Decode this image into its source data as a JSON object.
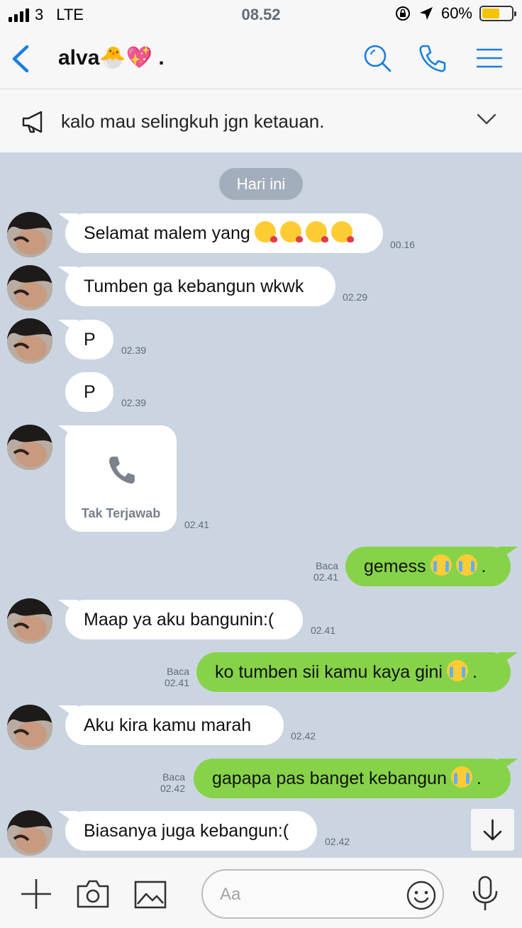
{
  "status_bar": {
    "carrier": "3",
    "network": "LTE",
    "time": "08.52",
    "battery": "60%",
    "battery_level": 0.6
  },
  "header": {
    "contact_name": "alva🐣💖 ."
  },
  "announcement": {
    "text": "kalo mau selingkuh jgn ketauan."
  },
  "chat": {
    "date_divider": "Hari ini",
    "messages": [
      {
        "text": "Selamat malem yang",
        "time": "00.16"
      },
      {
        "text": "Tumben ga kebangun wkwk",
        "time": "02.29"
      },
      {
        "text": "P",
        "time": "02.39"
      },
      {
        "text": "P",
        "time": "02.39"
      },
      {
        "call_label": "Tak Terjawab",
        "time": "02.41"
      },
      {
        "text": "gemess",
        "suffix": ".",
        "read": "Baca",
        "time": "02.41"
      },
      {
        "text": "Maap ya aku bangunin:(",
        "time": "02.41"
      },
      {
        "text": "ko tumben sii kamu kaya gini",
        "suffix": ".",
        "read": "Baca",
        "time": "02.41"
      },
      {
        "text": "Aku kira kamu marah",
        "time": "02.42"
      },
      {
        "text": "gapapa pas banget kebangun",
        "suffix": ".",
        "read": "Baca",
        "time": "02.42"
      },
      {
        "text": "Biasanya juga kebangun:(",
        "time": "02.42"
      }
    ]
  },
  "composer": {
    "placeholder": "Aa"
  },
  "colors": {
    "accent": "#1a7fe0",
    "chat_bg": "#cbd5e1",
    "outgoing_bubble": "#86d34a",
    "incoming_bubble": "#ffffff"
  }
}
